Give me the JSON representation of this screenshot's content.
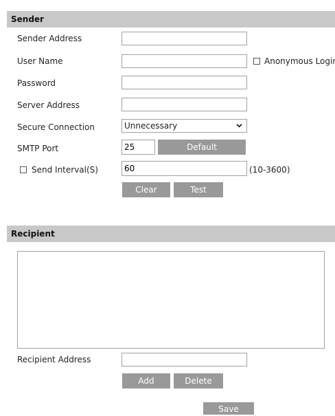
{
  "sender": {
    "header": "Sender",
    "sender_address_label": "Sender Address",
    "sender_address_value": "",
    "user_name_label": "User Name",
    "user_name_value": "",
    "anonymous_login_label": "Anonymous Login",
    "password_label": "Password",
    "password_value": "",
    "server_address_label": "Server Address",
    "server_address_value": "",
    "secure_connection_label": "Secure Connection",
    "secure_connection_value": "Unnecessary",
    "smtp_port_label": "SMTP Port",
    "smtp_port_value": "25",
    "default_button": "Default",
    "send_interval_label": "Send Interval(S)",
    "send_interval_value": "60",
    "send_interval_range": "(10-3600)",
    "clear_button": "Clear",
    "test_button": "Test"
  },
  "recipient": {
    "header": "Recipient",
    "recipient_address_label": "Recipient Address",
    "recipient_address_value": "",
    "add_button": "Add",
    "delete_button": "Delete"
  },
  "footer": {
    "save_button": "Save"
  }
}
